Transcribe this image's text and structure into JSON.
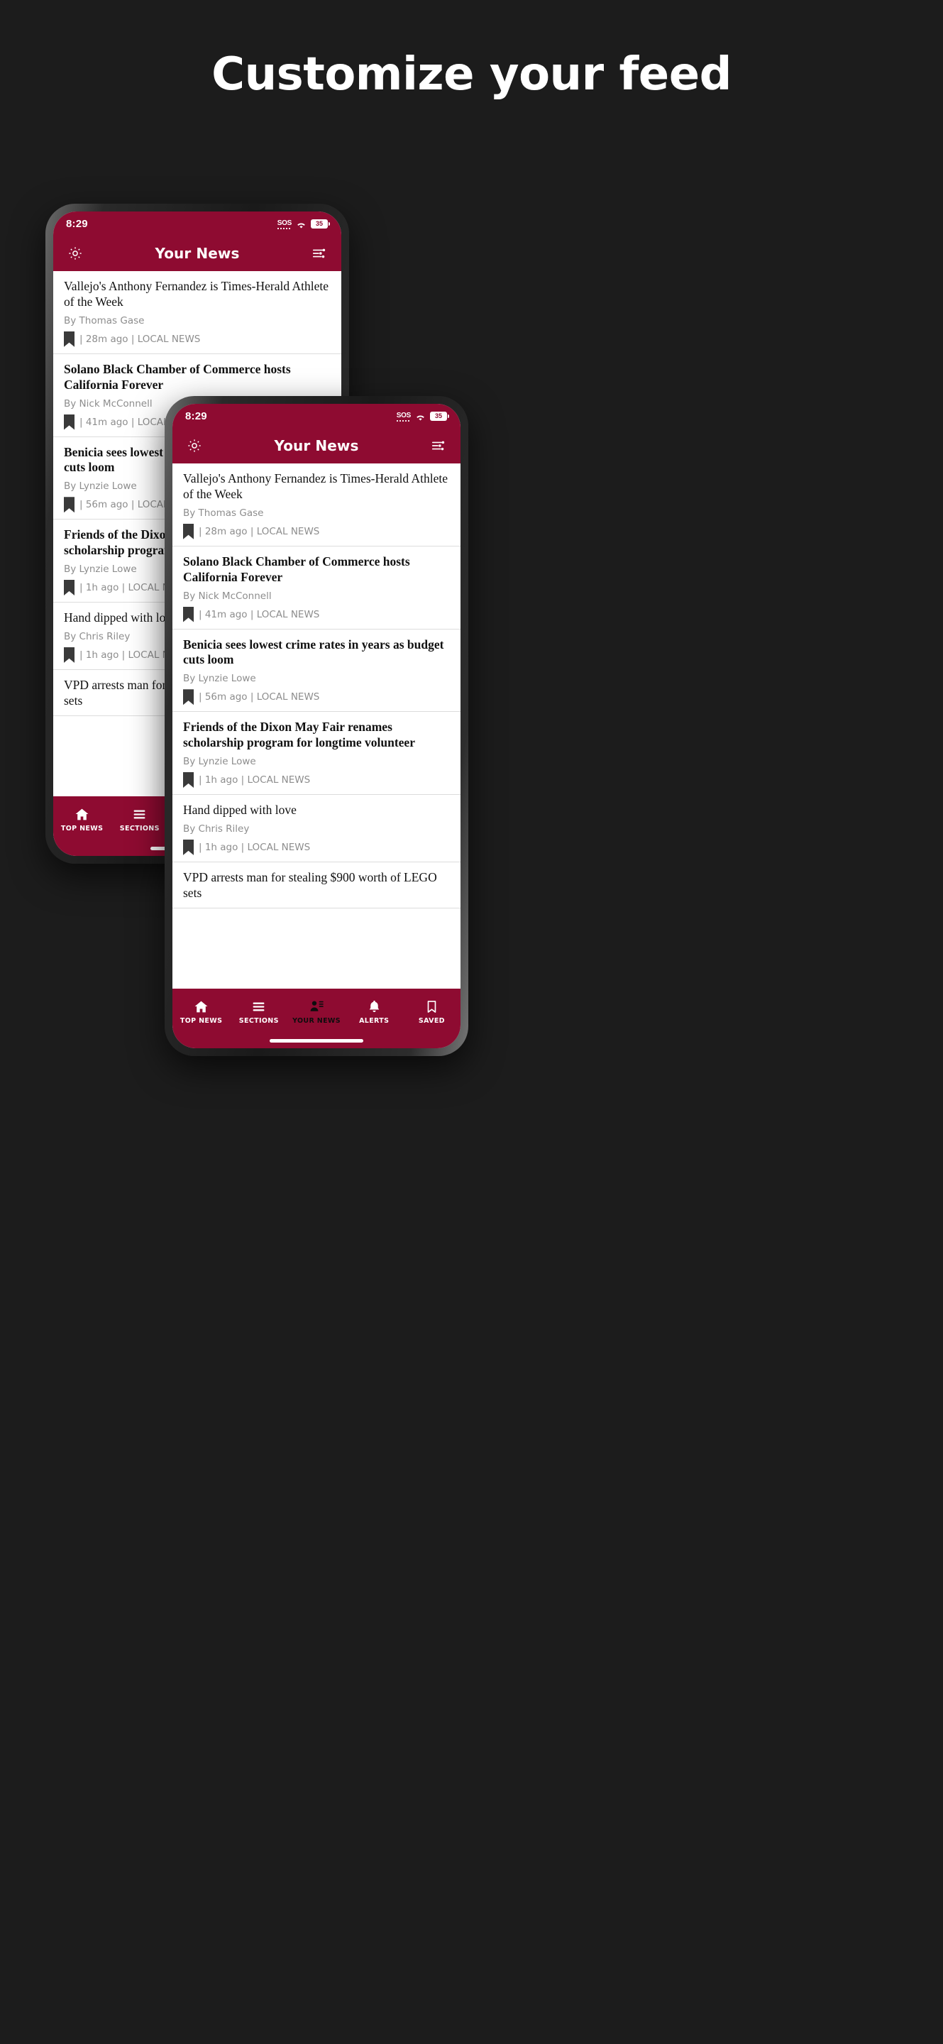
{
  "promo": {
    "headline": "Customize your feed"
  },
  "theme": {
    "brand": "#8e0b31",
    "background": "#1c1c1c",
    "feed_bg": "#ffffff",
    "muted": "#8d8d8d"
  },
  "phone": {
    "status": {
      "time": "8:29",
      "sos": "SOS",
      "battery": "35",
      "wifi_icon": "wifi-icon"
    },
    "appbar": {
      "title": "Your News",
      "left_icon": "settings-gear-icon",
      "right_icon": "filter-sliders-icon"
    },
    "articles": [
      {
        "title": "Vallejo's Anthony Fernandez is Times-Herald Athlete of the Week",
        "bold": false,
        "byline": "By Thomas Gase",
        "time": "| 28m ago |",
        "section": "LOCAL NEWS",
        "bookmark_icon": "bookmark-icon"
      },
      {
        "title": "Solano Black Chamber of Commerce hosts California Forever",
        "bold": true,
        "byline": "By Nick McConnell",
        "time": "| 41m ago |",
        "section": "LOCAL NEWS",
        "bookmark_icon": "bookmark-icon"
      },
      {
        "title": "Benicia sees lowest crime rates in years as budget cuts loom",
        "bold": true,
        "byline": "By Lynzie Lowe",
        "time": "| 56m ago |",
        "section": "LOCAL NEWS",
        "bookmark_icon": "bookmark-icon"
      },
      {
        "title": "Friends of the Dixon May Fair renames scholarship program for longtime volunteer",
        "bold": true,
        "byline": "By Lynzie Lowe",
        "time": "| 1h ago |",
        "section": "LOCAL NEWS",
        "bookmark_icon": "bookmark-icon"
      },
      {
        "title": "Hand dipped with love",
        "bold": false,
        "byline": "By Chris Riley",
        "time": "| 1h ago |",
        "section": "LOCAL NEWS",
        "bookmark_icon": "bookmark-icon"
      },
      {
        "title": "VPD arrests man for stealing $900 worth of LEGO sets",
        "bold": false,
        "byline": "",
        "time": "",
        "section": "",
        "bookmark_icon": "bookmark-icon"
      }
    ],
    "nav": [
      {
        "label": "TOP NEWS",
        "icon": "home-icon",
        "active": false
      },
      {
        "label": "SECTIONS",
        "icon": "hamburger-icon",
        "active": false
      },
      {
        "label": "YOUR NEWS",
        "icon": "person-list-icon",
        "active": true
      },
      {
        "label": "ALERTS",
        "icon": "bell-icon",
        "active": false
      },
      {
        "label": "SAVED",
        "icon": "bookmark-outline-icon",
        "active": false
      }
    ]
  }
}
